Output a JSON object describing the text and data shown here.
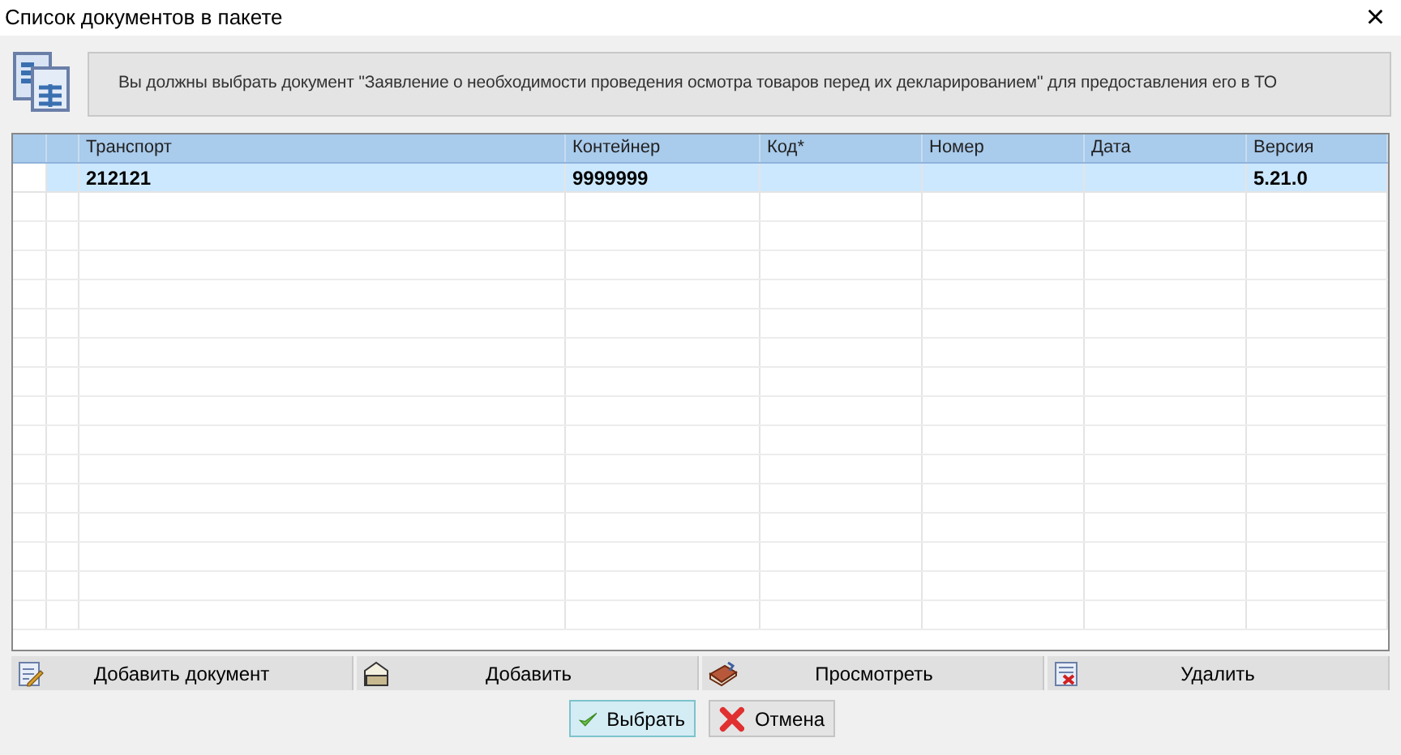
{
  "window": {
    "title": "Список документов в пакете",
    "close": "×"
  },
  "message": "Вы должны выбрать документ ''Заявление о необходимости проведения осмотра товаров перед их декларированием'' для предоставления его в ТО",
  "table": {
    "columns": [
      "Транспорт",
      "Контейнер",
      "Код*",
      "Номер",
      "Дата",
      "Версия"
    ],
    "rows": [
      {
        "selected": true,
        "cells": [
          "212121",
          "9999999",
          "",
          "",
          "",
          "5.21.0"
        ]
      }
    ]
  },
  "toolbar": [
    {
      "label": "Добавить документ",
      "kind": "edit"
    },
    {
      "label": "Добавить",
      "kind": "folder"
    },
    {
      "label": "Просмотреть",
      "kind": "book"
    },
    {
      "label": "Удалить",
      "kind": "delete"
    }
  ],
  "buttons": [
    {
      "label": "Выбрать",
      "kind": "ok",
      "focused": true
    },
    {
      "label": "Отмена",
      "kind": "cancel",
      "focused": false
    }
  ]
}
